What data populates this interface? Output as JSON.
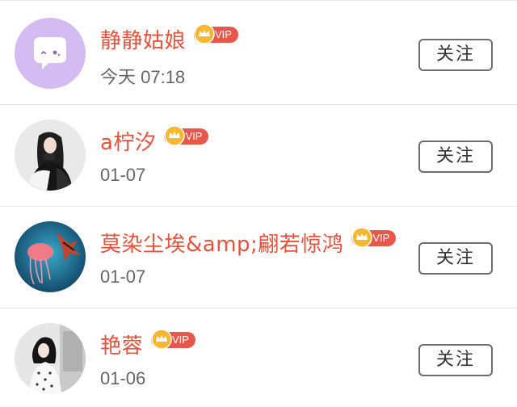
{
  "follow_list": {
    "users": [
      {
        "name": "静静姑娘",
        "badge": "VIP",
        "time": "今天 07:18",
        "follow_label": "关注",
        "avatar": "default-chat-avatar"
      },
      {
        "name": "a柠汐",
        "badge": "VIP",
        "time": "01-07",
        "follow_label": "关注",
        "avatar": "photo-avatar"
      },
      {
        "name": "莫染尘埃&amp;翩若惊鸿",
        "badge": "VIP",
        "time": "01-07",
        "follow_label": "关注",
        "avatar": "photo-avatar"
      },
      {
        "name": "艳蓉",
        "badge": "VIP",
        "time": "01-06",
        "follow_label": "关注",
        "avatar": "photo-avatar"
      }
    ]
  },
  "colors": {
    "name": "#e8513c",
    "vip_badge": "#e8574a",
    "crown": "#f5b82e",
    "default_avatar_bg": "#d2b8f0"
  }
}
